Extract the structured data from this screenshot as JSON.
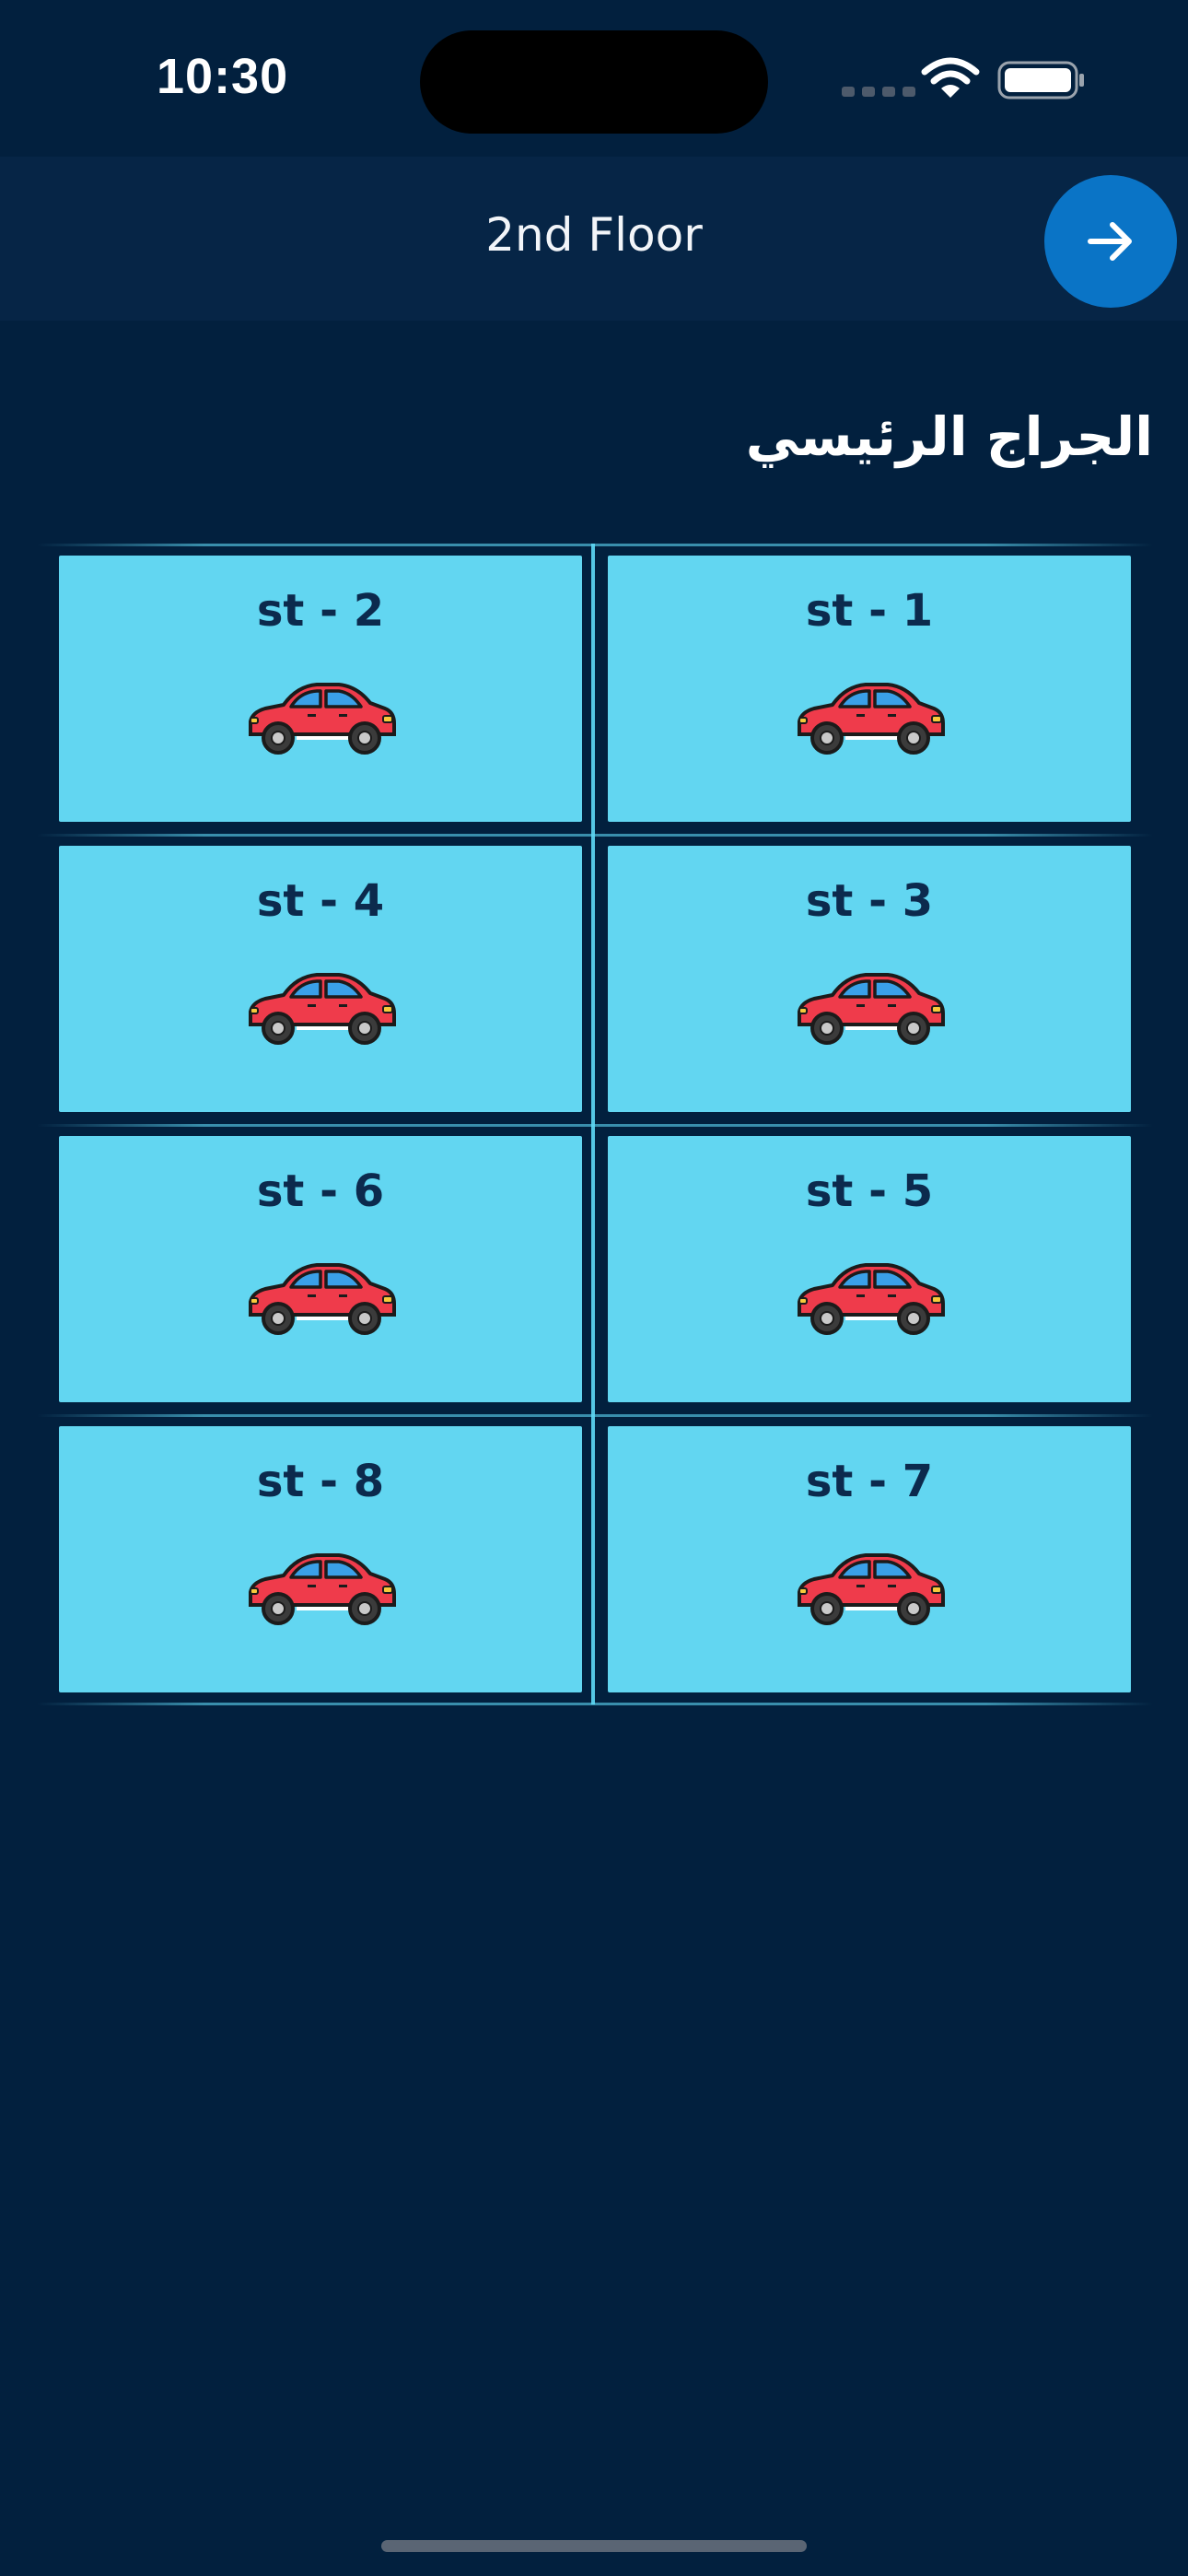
{
  "status_bar": {
    "time": "10:30"
  },
  "header": {
    "title": "2nd Floor",
    "next_icon": "arrow-right-icon"
  },
  "section": {
    "title": "الجراج الرئيسي"
  },
  "slots": [
    {
      "label": "st - 1",
      "icon": "car-icon"
    },
    {
      "label": "st - 2",
      "icon": "car-icon"
    },
    {
      "label": "st - 3",
      "icon": "car-icon"
    },
    {
      "label": "st - 4",
      "icon": "car-icon"
    },
    {
      "label": "st - 5",
      "icon": "car-icon"
    },
    {
      "label": "st - 6",
      "icon": "car-icon"
    },
    {
      "label": "st - 7",
      "icon": "car-icon"
    },
    {
      "label": "st - 8",
      "icon": "car-icon"
    }
  ],
  "colors": {
    "background": "#02203e",
    "header": "#062546",
    "slot": "#62d6f1",
    "accent": "#0a74c6",
    "car": "#ef3b4b"
  }
}
